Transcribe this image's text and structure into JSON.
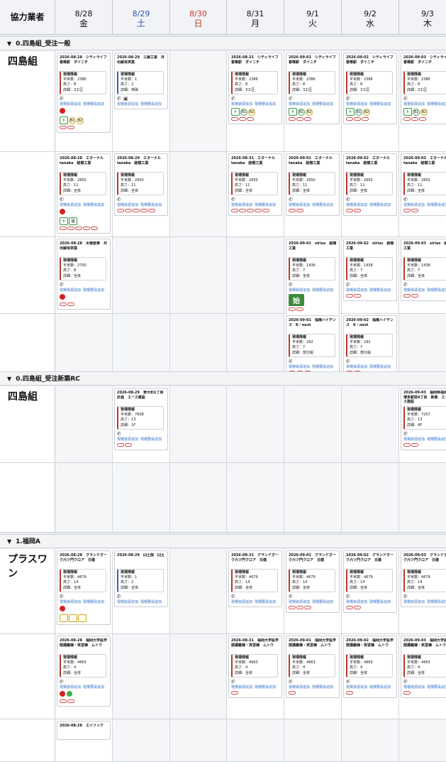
{
  "header": {
    "vendor_label": "協力業者",
    "days": [
      {
        "date": "8/28",
        "wd": "金",
        "color": "#111111"
      },
      {
        "date": "8/29",
        "wd": "土",
        "color": "#2a55b5"
      },
      {
        "date": "8/30",
        "wd": "日",
        "color": "#c73a32"
      },
      {
        "date": "8/31",
        "wd": "月",
        "color": "#111111"
      },
      {
        "date": "9/1",
        "wd": "火",
        "color": "#111111"
      },
      {
        "date": "9/2",
        "wd": "水",
        "color": "#111111"
      },
      {
        "date": "9/3",
        "wd": "木",
        "color": "#111111"
      }
    ]
  },
  "common": {
    "info_header": "現場情報",
    "area_prefix": "平米数：",
    "height_prefix": "高さ：",
    "detail_prefix": "詳細：",
    "link_material": "現場資源追加",
    "link_staff": "現場要員追加",
    "dot": "·",
    "start_label": "始"
  },
  "sections": [
    {
      "title": "0.四島組_受注一般",
      "vendor": "四島組",
      "rows": [
        {
          "cells": [
            {
              "title": "2026-08-28　シティライフ香椎駅　ダイニチ",
              "area": "2386",
              "height": "8",
              "detail": "3工区",
              "badges": "tb"
            },
            {
              "title": "2026-08-29　三扇工業　井出解体実業",
              "area": "1",
              "height": "2",
              "detail": "特殊",
              "blue": true,
              "extra": "phone2"
            },
            null,
            {
              "title": "2026-08-31　シティライフ香椎駅　ダイニチ",
              "area": "2386",
              "height": "8",
              "detail": "3工区",
              "badges": "t3"
            },
            {
              "title": "2026-09-01　シティライフ香椎駅　ダイニチ",
              "area": "2386",
              "height": "8",
              "detail": "3工区",
              "badges": "t3"
            },
            {
              "title": "2026-09-02　シティライフ香椎駅　ダイニチ",
              "area": "2386",
              "height": "8",
              "detail": "3工区",
              "badges": "t3"
            },
            {
              "title": "2026-09-03　シティライフ香椎駅　ダイニチ",
              "area": "2386",
              "height": "8",
              "detail": "3工区",
              "badges": "t3"
            }
          ]
        },
        {
          "cells": [
            {
              "title": "2026-08-28　エターナル　tanaka　結樹工業",
              "area": "2650",
              "height": "11",
              "detail": "全体",
              "badges": "red2"
            },
            {
              "title": "2026-08-29　エターナル　tanaka　結樹工業",
              "area": "2650",
              "height": "11",
              "detail": "全体",
              "pills": 5
            },
            null,
            {
              "title": "2026-08-31　エターナル　tanaka　結樹工業",
              "area": "2650",
              "height": "11",
              "detail": "全体",
              "pills": 5
            },
            {
              "title": "2026-09-01　エターナル　tanaka　結樹工業",
              "area": "2650",
              "height": "11",
              "detail": "全体",
              "pills": 2
            },
            {
              "title": "2026-09-02　エターナル　tanaka　結樹工業",
              "area": "2650",
              "height": "11",
              "detail": "全体",
              "pills": 2
            },
            {
              "title": "2026-09-03　エターナル　tanaka　結樹工業",
              "area": "2650",
              "height": "11",
              "detail": "全体",
              "pills": 2
            }
          ]
        },
        {
          "cells": [
            {
              "title": "2026-08-28　木徳倉庫　井出解体実業",
              "area": "2700",
              "height": "8",
              "detail": "全体",
              "badges": "red"
            },
            null,
            null,
            null,
            {
              "title": "2026-09-01　sirius　結樹工業",
              "area": "1438",
              "height": "7",
              "detail": "全体",
              "badges": "start"
            },
            {
              "title": "2026-09-02　sirius　結樹工業",
              "area": "1438",
              "height": "7",
              "detail": "全体",
              "pills": 2
            },
            {
              "title": "2026-09-03　sirius　結樹工業",
              "area": "1438",
              "height": "7",
              "detail": "全体",
              "pills": 2
            }
          ]
        },
        {
          "cells": [
            null,
            null,
            null,
            null,
            {
              "title": "2026-09-01　福隆ハイデンス　K・next",
              "area": "292",
              "height": "7",
              "detail": "部分組",
              "pills": 3
            },
            {
              "title": "2026-09-02　福隆ハイデンス　K・next",
              "area": "292",
              "height": "7",
              "detail": "部分組",
              "pills": 2
            },
            null
          ]
        }
      ]
    },
    {
      "title": "0.四島組_受注新築RC",
      "vendor": "四島組",
      "rows": [
        {
          "cells": [
            null,
            {
              "title": "2026-08-29　東大利1丁目計画　エース建設",
              "area": "7608",
              "height": "13",
              "detail": "1F",
              "pills": 2
            },
            null,
            null,
            null,
            null,
            {
              "title": "2026-09-03　福岡県福岡市博多駅前4丁目　新築　エース建設",
              "area": "7257",
              "height": "13",
              "detail": "9F",
              "pills": 2
            }
          ]
        },
        {
          "cells": [
            null,
            null,
            null,
            null,
            null,
            null,
            null
          ]
        }
      ]
    },
    {
      "title": "1.福岡A",
      "vendor": "プラスワン",
      "rows": [
        {
          "cells": [
            {
              "title": "2026-08-28　グランドオーク六ツ門クロア　日建",
              "area": "4679",
              "height": "14",
              "detail": "全体",
              "badges": "redsq"
            },
            {
              "title": "2026-08-29　臼土部　臼土",
              "area": "1",
              "height": "2",
              "detail": "全体",
              "blue": true
            },
            null,
            {
              "title": "2026-08-31　グランドオーク六ツ門クロア　日建",
              "area": "4679",
              "height": "14",
              "detail": "全体"
            },
            {
              "title": "2026-09-01　グランドオーク六ツ門クロア　日建",
              "area": "4679",
              "height": "14",
              "detail": "全体",
              "pills": 3
            },
            {
              "title": "2026-09-02　グランドオーク六ツ門クロア　日建",
              "area": "4679",
              "height": "14",
              "detail": "全体",
              "pills": 2
            },
            {
              "title": "2026-09-03　グランドオーク六ツ門クロア　日建",
              "area": "4679",
              "height": "14",
              "detail": "全体"
            }
          ]
        },
        {
          "cells": [
            {
              "title": "2026-08-28　福岡大学医学部講義棟・実習棟　ムトウ",
              "area": "4663",
              "height": "4",
              "detail": "全体",
              "badges": "redgrn"
            },
            null,
            null,
            {
              "title": "2026-08-31　福岡大学医学部講義棟・実習棟　ムトウ",
              "area": "4663",
              "height": "4",
              "detail": "全体",
              "pills": 1
            },
            {
              "title": "2026-09-01　福岡大学医学部講義棟・実習棟　ムトウ",
              "area": "4663",
              "height": "4",
              "detail": "全体",
              "pills": 1
            },
            {
              "title": "2026-09-02　福岡大学医学部講義棟・実習棟　ムトウ",
              "area": "4663",
              "height": "4",
              "detail": "全体",
              "pills": 1
            },
            {
              "title": "2026-09-03　福岡大学医学部講義棟・実習棟　ムトウ",
              "area": "4663",
              "height": "4",
              "detail": "全体",
              "pills": 1
            }
          ]
        },
        {
          "cells": [
            {
              "title": "2026-08-28　エイリック",
              "area": "",
              "height": "",
              "detail": ""
            },
            null,
            null,
            null,
            null,
            null,
            null
          ]
        }
      ]
    }
  ],
  "badge_text": {
    "t": "ト",
    "b1": "B1",
    "b2": "B2",
    "f": "福"
  }
}
